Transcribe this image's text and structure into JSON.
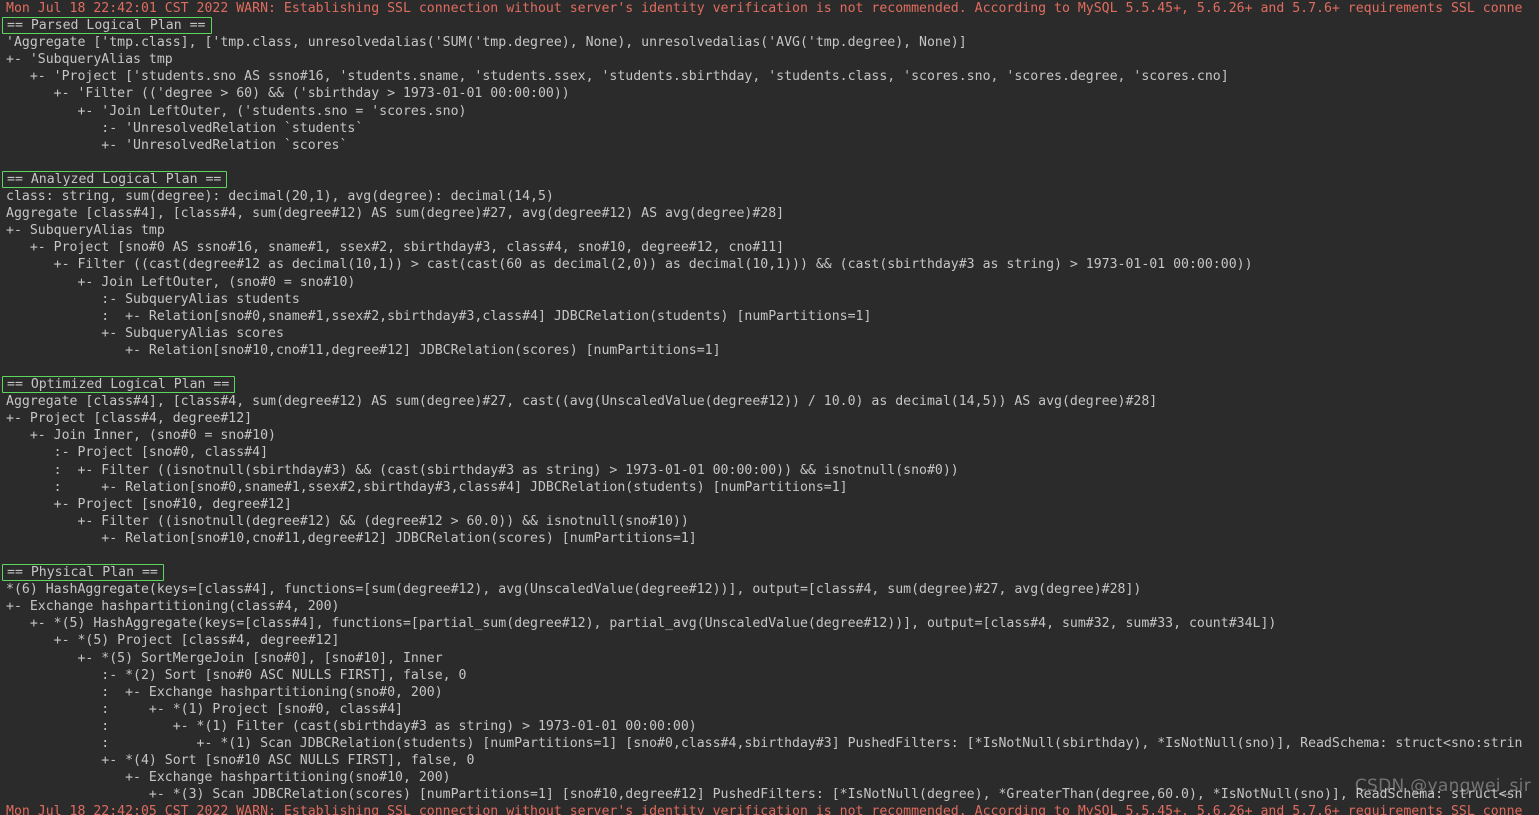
{
  "theme": {
    "background": "#2b2b2b",
    "text_color": "#c8c8c8",
    "warn_color": "#e06c5f",
    "highlight_border": "#5bd75b",
    "watermark_color": "#e1e1e1"
  },
  "watermark": {
    "text": "CSDN @yangwei_sir"
  },
  "console": {
    "lines": [
      {
        "kind": "warn",
        "text": "Mon Jul 18 22:42:01 CST 2022 WARN: Establishing SSL connection without server's identity verification is not recommended. According to MySQL 5.5.45+, 5.6.26+ and 5.7.6+ requirements SSL conne"
      },
      {
        "kind": "header",
        "text": "== Parsed Logical Plan =="
      },
      {
        "kind": "plain",
        "text": "'Aggregate ['tmp.class], ['tmp.class, unresolvedalias('SUM('tmp.degree), None), unresolvedalias('AVG('tmp.degree), None)]"
      },
      {
        "kind": "plain",
        "text": "+- 'SubqueryAlias tmp"
      },
      {
        "kind": "plain",
        "text": "   +- 'Project ['students.sno AS ssno#16, 'students.sname, 'students.ssex, 'students.sbirthday, 'students.class, 'scores.sno, 'scores.degree, 'scores.cno]"
      },
      {
        "kind": "plain",
        "text": "      +- 'Filter (('degree > 60) && ('sbirthday > 1973-01-01 00:00:00))"
      },
      {
        "kind": "plain",
        "text": "         +- 'Join LeftOuter, ('students.sno = 'scores.sno)"
      },
      {
        "kind": "plain",
        "text": "            :- 'UnresolvedRelation `students`"
      },
      {
        "kind": "plain",
        "text": "            +- 'UnresolvedRelation `scores`"
      },
      {
        "kind": "blank",
        "text": ""
      },
      {
        "kind": "header",
        "text": "== Analyzed Logical Plan =="
      },
      {
        "kind": "plain",
        "text": "class: string, sum(degree): decimal(20,1), avg(degree): decimal(14,5)"
      },
      {
        "kind": "plain",
        "text": "Aggregate [class#4], [class#4, sum(degree#12) AS sum(degree)#27, avg(degree#12) AS avg(degree)#28]"
      },
      {
        "kind": "plain",
        "text": "+- SubqueryAlias tmp"
      },
      {
        "kind": "plain",
        "text": "   +- Project [sno#0 AS ssno#16, sname#1, ssex#2, sbirthday#3, class#4, sno#10, degree#12, cno#11]"
      },
      {
        "kind": "plain",
        "text": "      +- Filter ((cast(degree#12 as decimal(10,1)) > cast(cast(60 as decimal(2,0)) as decimal(10,1))) && (cast(sbirthday#3 as string) > 1973-01-01 00:00:00))"
      },
      {
        "kind": "plain",
        "text": "         +- Join LeftOuter, (sno#0 = sno#10)"
      },
      {
        "kind": "plain",
        "text": "            :- SubqueryAlias students"
      },
      {
        "kind": "plain",
        "text": "            :  +- Relation[sno#0,sname#1,ssex#2,sbirthday#3,class#4] JDBCRelation(students) [numPartitions=1]"
      },
      {
        "kind": "plain",
        "text": "            +- SubqueryAlias scores"
      },
      {
        "kind": "plain",
        "text": "               +- Relation[sno#10,cno#11,degree#12] JDBCRelation(scores) [numPartitions=1]"
      },
      {
        "kind": "blank",
        "text": ""
      },
      {
        "kind": "header",
        "text": "== Optimized Logical Plan =="
      },
      {
        "kind": "plain",
        "text": "Aggregate [class#4], [class#4, sum(degree#12) AS sum(degree)#27, cast((avg(UnscaledValue(degree#12)) / 10.0) as decimal(14,5)) AS avg(degree)#28]"
      },
      {
        "kind": "plain",
        "text": "+- Project [class#4, degree#12]"
      },
      {
        "kind": "plain",
        "text": "   +- Join Inner, (sno#0 = sno#10)"
      },
      {
        "kind": "plain",
        "text": "      :- Project [sno#0, class#4]"
      },
      {
        "kind": "plain",
        "text": "      :  +- Filter ((isnotnull(sbirthday#3) && (cast(sbirthday#3 as string) > 1973-01-01 00:00:00)) && isnotnull(sno#0))"
      },
      {
        "kind": "plain",
        "text": "      :     +- Relation[sno#0,sname#1,ssex#2,sbirthday#3,class#4] JDBCRelation(students) [numPartitions=1]"
      },
      {
        "kind": "plain",
        "text": "      +- Project [sno#10, degree#12]"
      },
      {
        "kind": "plain",
        "text": "         +- Filter ((isnotnull(degree#12) && (degree#12 > 60.0)) && isnotnull(sno#10))"
      },
      {
        "kind": "plain",
        "text": "            +- Relation[sno#10,cno#11,degree#12] JDBCRelation(scores) [numPartitions=1]"
      },
      {
        "kind": "blank",
        "text": ""
      },
      {
        "kind": "header",
        "text": "== Physical Plan =="
      },
      {
        "kind": "plain",
        "text": "*(6) HashAggregate(keys=[class#4], functions=[sum(degree#12), avg(UnscaledValue(degree#12))], output=[class#4, sum(degree)#27, avg(degree)#28])"
      },
      {
        "kind": "plain",
        "text": "+- Exchange hashpartitioning(class#4, 200)"
      },
      {
        "kind": "plain",
        "text": "   +- *(5) HashAggregate(keys=[class#4], functions=[partial_sum(degree#12), partial_avg(UnscaledValue(degree#12))], output=[class#4, sum#32, sum#33, count#34L])"
      },
      {
        "kind": "plain",
        "text": "      +- *(5) Project [class#4, degree#12]"
      },
      {
        "kind": "plain",
        "text": "         +- *(5) SortMergeJoin [sno#0], [sno#10], Inner"
      },
      {
        "kind": "plain",
        "text": "            :- *(2) Sort [sno#0 ASC NULLS FIRST], false, 0"
      },
      {
        "kind": "plain",
        "text": "            :  +- Exchange hashpartitioning(sno#0, 200)"
      },
      {
        "kind": "plain",
        "text": "            :     +- *(1) Project [sno#0, class#4]"
      },
      {
        "kind": "plain",
        "text": "            :        +- *(1) Filter (cast(sbirthday#3 as string) > 1973-01-01 00:00:00)"
      },
      {
        "kind": "plain",
        "text": "            :           +- *(1) Scan JDBCRelation(students) [numPartitions=1] [sno#0,class#4,sbirthday#3] PushedFilters: [*IsNotNull(sbirthday), *IsNotNull(sno)], ReadSchema: struct<sno:strin"
      },
      {
        "kind": "plain",
        "text": "            +- *(4) Sort [sno#10 ASC NULLS FIRST], false, 0"
      },
      {
        "kind": "plain",
        "text": "               +- Exchange hashpartitioning(sno#10, 200)"
      },
      {
        "kind": "plain",
        "text": "                  +- *(3) Scan JDBCRelation(scores) [numPartitions=1] [sno#10,degree#12] PushedFilters: [*IsNotNull(degree), *GreaterThan(degree,60.0), *IsNotNull(sno)], ReadSchema: struct<sn"
      },
      {
        "kind": "warn",
        "text": "Mon Jul 18 22:42:05 CST 2022 WARN: Establishing SSL connection without server's identity verification is not recommended. According to MySQL 5.5.45+, 5.6.26+ and 5.7.6+ requirements SSL conne"
      }
    ]
  }
}
